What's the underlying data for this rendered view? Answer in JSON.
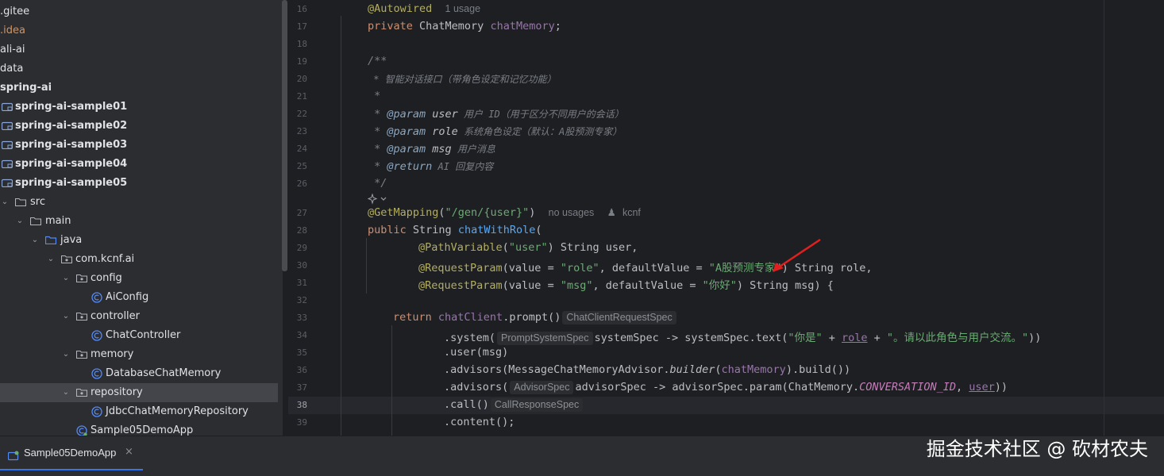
{
  "tree": {
    "items": [
      {
        "label": ".gitee"
      },
      {
        "label": ".idea"
      },
      {
        "label": "ali-ai"
      },
      {
        "label": "data"
      },
      {
        "label": "spring-ai"
      },
      {
        "label": "spring-ai-sample01"
      },
      {
        "label": "spring-ai-sample02"
      },
      {
        "label": "spring-ai-sample03"
      },
      {
        "label": "spring-ai-sample04"
      },
      {
        "label": "spring-ai-sample05"
      },
      {
        "label": "src"
      },
      {
        "label": "main"
      },
      {
        "label": "java"
      },
      {
        "label": "com.kcnf.ai"
      },
      {
        "label": "config"
      },
      {
        "label": "AiConfig"
      },
      {
        "label": "controller"
      },
      {
        "label": "ChatController"
      },
      {
        "label": "memory"
      },
      {
        "label": "DatabaseChatMemory"
      },
      {
        "label": "repository"
      },
      {
        "label": "JdbcChatMemoryRepository"
      },
      {
        "label": "Sample05DemoApp"
      }
    ]
  },
  "editor": {
    "line_numbers": [
      "16",
      "17",
      "18",
      "19",
      "20",
      "21",
      "22",
      "23",
      "24",
      "25",
      "26",
      "27",
      "28",
      "29",
      "30",
      "31",
      "32",
      "33",
      "34",
      "35",
      "36",
      "37",
      "38",
      "39"
    ],
    "current_line": "38",
    "code": {
      "l16_ann": "@Autowired",
      "l16_meta": "1 usage",
      "l17_kw": "private ",
      "l17_type": "ChatMemory ",
      "l17_field": "chatMemory",
      "l17_end": ";",
      "l19": "/**",
      "l20": " * 智能对话接口（带角色设定和记忆功能）",
      "l21": " *",
      "l22_pre": " * ",
      "l22_tag": "@param",
      "l22_name": " user",
      "l22_desc": " 用户 ID（用于区分不同用户的会话）",
      "l23_pre": " * ",
      "l23_tag": "@param",
      "l23_name": " role",
      "l23_desc": " 系统角色设定（默认：A股预测专家）",
      "l24_pre": " * ",
      "l24_tag": "@param",
      "l24_name": " msg",
      "l24_desc": " 用户消息",
      "l25_pre": " * ",
      "l25_tag": "@return",
      "l25_desc": " AI 回复内容",
      "l26": " */",
      "l27_ann": "@GetMapping",
      "l27_open": "(",
      "l27_str": "\"/gen/{user}\"",
      "l27_close": ")",
      "l27_meta1": "no usages",
      "l27_meta2": "kcnf",
      "l28_kw": "public ",
      "l28_type": "String ",
      "l28_fn": "chatWithRole",
      "l28_end": "(",
      "l29_ann": "@PathVariable",
      "l29_open": "(",
      "l29_str": "\"user\"",
      "l29_end": ") String user,",
      "l30_ann": "@RequestParam",
      "l30_a": "(value = ",
      "l30_s1": "\"role\"",
      "l30_b": ", defaultValue = ",
      "l30_s2": "\"A股预测专家\"",
      "l30_end": ") String role,",
      "l31_ann": "@RequestParam",
      "l31_a": "(value = ",
      "l31_s1": "\"msg\"",
      "l31_b": ", defaultValue = ",
      "l31_s2": "\"你好\"",
      "l31_end": ") String msg) {",
      "l33_kw": "return ",
      "l33_field": "chatClient",
      "l33_rest": ".prompt()",
      "l33_hint": "ChatClientRequestSpec",
      "l34_a": ".system(",
      "l34_hint": "PromptSystemSpec",
      "l34_b": "systemSpec -> systemSpec.text(",
      "l34_s1": "\"你是\"",
      "l34_c": " + ",
      "l34_role": "role",
      "l34_d": " + ",
      "l34_s2": "\"。请以此角色与用户交流。\"",
      "l34_end": "))",
      "l35": ".user(msg)",
      "l36_a": ".advisors(MessageChatMemoryAdvisor.",
      "l36_fn": "builder",
      "l36_b": "(",
      "l36_field": "chatMemory",
      "l36_end": ").build())",
      "l37_a": ".advisors(",
      "l37_hint": "AdvisorSpec",
      "l37_b": "advisorSpec -> advisorSpec.param(ChatMemory.",
      "l37_const": "CONVERSATION_ID",
      "l37_c": ", ",
      "l37_user": "user",
      "l37_end": "))",
      "l38_a": ".call()",
      "l38_hint": "CallResponseSpec",
      "l39": ".content();"
    }
  },
  "bottom": {
    "run_tab_label": "Sample05DemoApp",
    "close_glyph": "×"
  },
  "watermark": "掘金技术社区 @ 砍材农夫",
  "colors": {
    "background": "#1e1f22",
    "panel": "#2b2d30",
    "keyword": "#cf8e6d",
    "annotation": "#b3ae60",
    "string": "#6aab73",
    "field": "#9876aa",
    "comment": "#7a7e85",
    "arrow": "#e0201f",
    "accent": "#3574f0"
  }
}
